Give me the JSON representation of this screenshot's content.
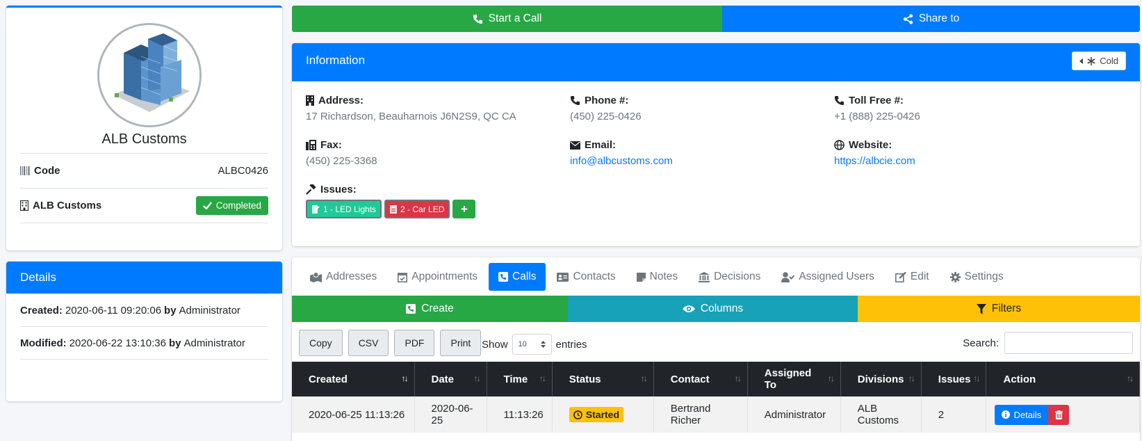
{
  "profile": {
    "name": "ALB Customs",
    "code_label": "Code",
    "code_value": "ALBC0426",
    "company_label": "ALB Customs",
    "status_button": "Completed"
  },
  "details": {
    "title": "Details",
    "created_label": "Created:",
    "created_value": "2020-06-11 09:20:06",
    "created_by_label": "by",
    "created_by": "Administrator",
    "modified_label": "Modified:",
    "modified_value": "2020-06-22 13:10:36",
    "modified_by_label": "by",
    "modified_by": "Administrator"
  },
  "topbar": {
    "call_label": "Start a Call",
    "share_label": "Share to"
  },
  "info": {
    "title": "Information",
    "temperature_button": "Cold",
    "address_label": "Address:",
    "address_value": "17 Richardson, Beauharnois J6N2S9, QC CA",
    "phone_label": "Phone #:",
    "phone_value": "(450) 225-0426",
    "tollfree_label": "Toll Free #:",
    "tollfree_value": "+1 (888) 225-0426",
    "fax_label": "Fax:",
    "fax_value": "(450) 225-3368",
    "email_label": "Email:",
    "email_value": "info@albcustoms.com",
    "website_label": "Website:",
    "website_value": "https://albcie.com",
    "issues_label": "Issues:",
    "issues": [
      "1 - LED Lights",
      "2 - Car LED"
    ],
    "add_issue": "+"
  },
  "tabs": [
    "Addresses",
    "Appointments",
    "Calls",
    "Contacts",
    "Notes",
    "Decisions",
    "Assigned Users",
    "Edit",
    "Settings"
  ],
  "actionbar": {
    "create": "Create",
    "columns": "Columns",
    "filters": "Filters"
  },
  "table_controls": {
    "buttons": [
      "Copy",
      "CSV",
      "PDF",
      "Print"
    ],
    "show_label": "Show",
    "entries_value": "10",
    "entries_label": "entries",
    "search_label": "Search:"
  },
  "table": {
    "headers": [
      "Created",
      "Date",
      "Time",
      "Status",
      "Contact",
      "Assigned To",
      "Divisions",
      "Issues",
      "Action"
    ],
    "rows": [
      {
        "created": "2020-06-25 11:13:26",
        "date": "2020-06-25",
        "time": "11:13:26",
        "status": "Started",
        "contact": "Bertrand Richer",
        "assigned_to": "Administrator",
        "divisions": "ALB Customs",
        "issues": "2",
        "action": "Details"
      }
    ]
  }
}
